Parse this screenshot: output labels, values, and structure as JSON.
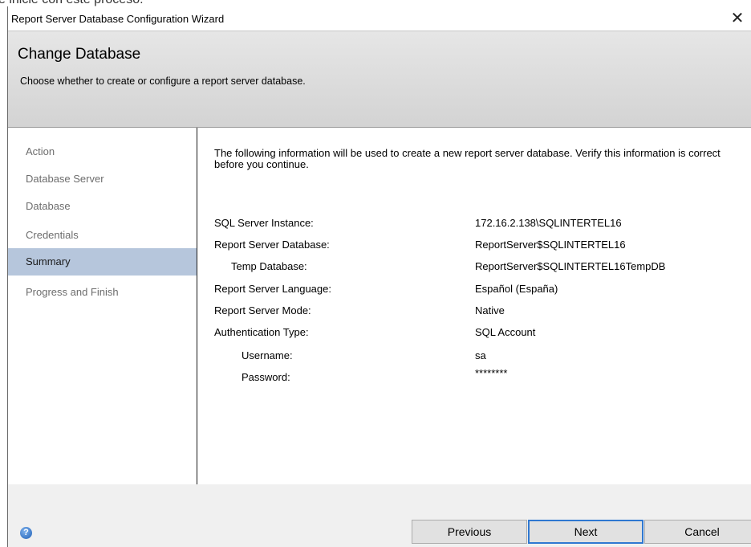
{
  "background_text": "e inicie con este proceso:",
  "window": {
    "title": "Report Server Database Configuration Wizard",
    "close_glyph": "✕"
  },
  "header": {
    "title": "Change Database",
    "subtitle": "Choose whether to create or configure a report server database."
  },
  "sidebar": {
    "items": [
      {
        "label": "Action",
        "selected": false
      },
      {
        "label": "Database Server",
        "selected": false
      },
      {
        "label": "Database",
        "selected": false
      },
      {
        "label": "Credentials",
        "selected": false
      },
      {
        "label": "Summary",
        "selected": true
      },
      {
        "label": "Progress and Finish",
        "selected": false
      }
    ]
  },
  "summary": {
    "intro": "The following information will be used to create a new report server database. Verify this information is correct before you continue.",
    "rows": [
      {
        "label": "SQL Server Instance:",
        "value": "172.16.2.138\\SQLINTERTEL16"
      },
      {
        "label": "Report Server Database:",
        "value": "ReportServer$SQLINTERTEL16"
      },
      {
        "label": "Temp Database:",
        "value": "ReportServer$SQLINTERTEL16TempDB"
      },
      {
        "label": "Report Server Language:",
        "value": "Español (España)"
      },
      {
        "label": "Report Server Mode:",
        "value": "Native"
      },
      {
        "label": "Authentication Type:",
        "value": "SQL Account"
      },
      {
        "label": "Username:",
        "value": "sa"
      },
      {
        "label": "Password:",
        "value": "********"
      }
    ]
  },
  "footer": {
    "help_icon": "help-icon",
    "help_glyph": "?",
    "previous_label": "Previous",
    "next_label": "Next",
    "cancel_label": "Cancel"
  },
  "colors": {
    "selected_nav_bg": "#b6c6dc",
    "primary_button_border": "#2f78d1"
  }
}
